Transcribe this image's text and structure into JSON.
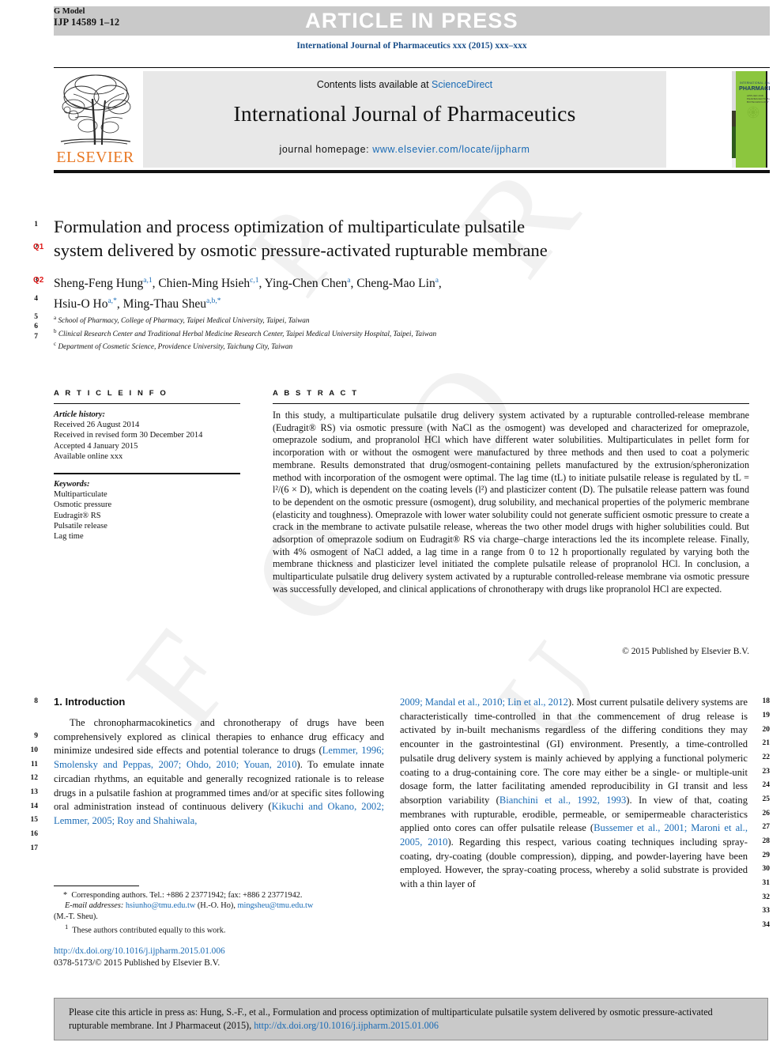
{
  "header": {
    "g_model_line1": "G Model",
    "g_model_line2": "IJP 14589 1–12",
    "banner": "ARTICLE IN PRESS",
    "journal_line": "International Journal of Pharmaceutics xxx (2015) xxx–xxx"
  },
  "masthead": {
    "contents_prefix": "Contents lists available at ",
    "contents_link": "ScienceDirect",
    "journal_name": "International Journal of Pharmaceutics",
    "homepage_prefix": "journal homepage: ",
    "homepage_link": "www.elsevier.com/locate/ijpharm",
    "publisher": "ELSEVIER",
    "cover_title_small": "INTERNATIONAL JOURNAL OF",
    "cover_title_big": "PHARMACEUTICS",
    "link_color": "#1a6bb5",
    "banner_bg": "#c9c9c9",
    "panel_bg": "#e8e8e8",
    "elsevier_orange": "#e87722"
  },
  "article": {
    "title_line1": "Formulation and process optimization of multiparticulate pulsatile",
    "title_line2": "system delivered by osmotic pressure-activated rupturable membrane",
    "authors_line1": "Sheng-Feng Hung a,1, Chien-Ming Hsieh c,1, Ying-Chen Chen a, Cheng-Mao Lin a,",
    "authors_line2": "Hsiu-O Ho a,*, Ming-Thau Sheu a,b,*",
    "affiliation_a": "School of Pharmacy, College of Pharmacy, Taipei Medical University, Taipei, Taiwan",
    "affiliation_b": "Clinical Research Center and Traditional Herbal Medicine Research Center, Taipei Medical University Hospital, Taipei, Taiwan",
    "affiliation_c": "Department of Cosmetic Science, Providence University, Taichung City, Taiwan"
  },
  "article_info": {
    "heading": "A R T I C L E   I N F O",
    "history_label": "Article history:",
    "history": [
      "Received 26 August 2014",
      "Received in revised form 30 December 2014",
      "Accepted 4 January 2015",
      "Available online xxx"
    ],
    "keywords_label": "Keywords:",
    "keywords": [
      "Multiparticulate",
      "Osmotic pressure",
      "Eudragit® RS",
      "Pulsatile release",
      "Lag time"
    ]
  },
  "abstract": {
    "heading": "A B S T R A C T",
    "text": "In this study, a multiparticulate pulsatile drug delivery system activated by a rupturable controlled-release membrane (Eudragit® RS) via osmotic pressure (with NaCl as the osmogent) was developed and characterized for omeprazole, omeprazole sodium, and propranolol HCl which have different water solubilities. Multiparticulates in pellet form for incorporation with or without the osmogent were manufactured by three methods and then used to coat a polymeric membrane. Results demonstrated that drug/osmogent-containing pellets manufactured by the extrusion/spheronization method with incorporation of the osmogent were optimal. The lag time (tL) to initiate pulsatile release is regulated by tL = l²/(6 × D), which is dependent on the coating levels (l²) and plasticizer content (D). The pulsatile release pattern was found to be dependent on the osmotic pressure (osmogent), drug solubility, and mechanical properties of the polymeric membrane (elasticity and toughness). Omeprazole with lower water solubility could not generate sufficient osmotic pressure to create a crack in the membrane to activate pulsatile release, whereas the two other model drugs with higher solubilities could. But adsorption of omeprazole sodium on Eudragit® RS via charge–charge interactions led the its incomplete release. Finally, with 4% osmogent of NaCl added, a lag time in a range from 0 to 12 h proportionally regulated by varying both the membrane thickness and plasticizer level initiated the complete pulsatile release of propranolol HCl. In conclusion, a multiparticulate pulsatile drug delivery system activated by a rupturable controlled-release membrane via osmotic pressure was successfully developed, and clinical applications of chronotherapy with drugs like propranolol HCl are expected.",
    "copyright": "© 2015 Published by Elsevier B.V."
  },
  "body": {
    "section_heading": "1. Introduction",
    "left_paragraph": "The chronopharmacokinetics and chronotherapy of drugs have been comprehensively explored as clinical therapies to enhance drug efficacy and minimize undesired side effects and potential tolerance to drugs (Lemmer, 1996; Smolensky and Peppas, 2007; Ohdo, 2010; Youan, 2010). To emulate innate circadian rhythms, an equitable and generally recognized rationale is to release drugs in a pulsatile fashion at programmed times and/or at specific sites following oral administration instead of continuous delivery (Kikuchi and Okano, 2002; Lemmer, 2005; Roy and Shahiwala,",
    "right_paragraph": "2009; Mandal et al., 2010; Lin et al., 2012). Most current pulsatile delivery systems are characteristically time-controlled in that the commencement of drug release is activated by in-built mechanisms regardless of the differing conditions they may encounter in the gastrointestinal (GI) environment. Presently, a time-controlled pulsatile drug delivery system is mainly achieved by applying a functional polymeric coating to a drug-containing core. The core may either be a single- or multiple-unit dosage form, the latter facilitating amended reproducibility in GI transit and less absorption variability (Bianchini et al., 1992, 1993). In view of that, coating membranes with rupturable, erodible, permeable, or semipermeable characteristics applied onto cores can offer pulsatile release (Bussemer et al., 2001; Maroni et al., 2005, 2010). Regarding this respect, various coating techniques including spray-coating, dry-coating (double compression), dipping, and powder-layering have been employed. However, the spray-coating process, whereby a solid substrate is provided with a thin layer of"
  },
  "footnotes": {
    "corresponding": "Corresponding authors. Tel.: +886 2 23771942; fax: +886 2 23771942.",
    "email_label": "E-mail addresses:",
    "email1": "hsiunho@tmu.edu.tw",
    "email1_name": "(H.-O. Ho),",
    "email2": "mingsheu@tmu.edu.tw",
    "email2_name": "(M.-T. Sheu).",
    "equal_contrib": "These authors contributed equally to this work.",
    "doi_url": "http://dx.doi.org/10.1016/j.ijpharm.2015.01.006",
    "issn_line": "0378-5173/© 2015 Published by Elsevier B.V."
  },
  "cite_box": {
    "text_part1": "Please cite this article in press as: Hung, S.-F., et al., Formulation and process optimization of multiparticulate pulsatile system delivered by osmotic pressure-activated rupturable membrane. Int J Pharmaceut (2015), ",
    "link": "http://dx.doi.org/10.1016/j.ijpharm.2015.01.006"
  },
  "line_numbers": {
    "title_block": [
      "1",
      "2",
      "3",
      "4",
      "5",
      "6",
      "7"
    ],
    "query_tags": [
      "Q1",
      "Q2"
    ],
    "left_column": [
      "8",
      "9",
      "10",
      "11",
      "12",
      "13",
      "14",
      "15",
      "16",
      "17"
    ],
    "right_column": [
      "18",
      "19",
      "20",
      "21",
      "22",
      "23",
      "24",
      "25",
      "26",
      "27",
      "28",
      "29",
      "30",
      "31",
      "32",
      "33",
      "34"
    ]
  },
  "watermark": "UNCORRECTED PROOF"
}
